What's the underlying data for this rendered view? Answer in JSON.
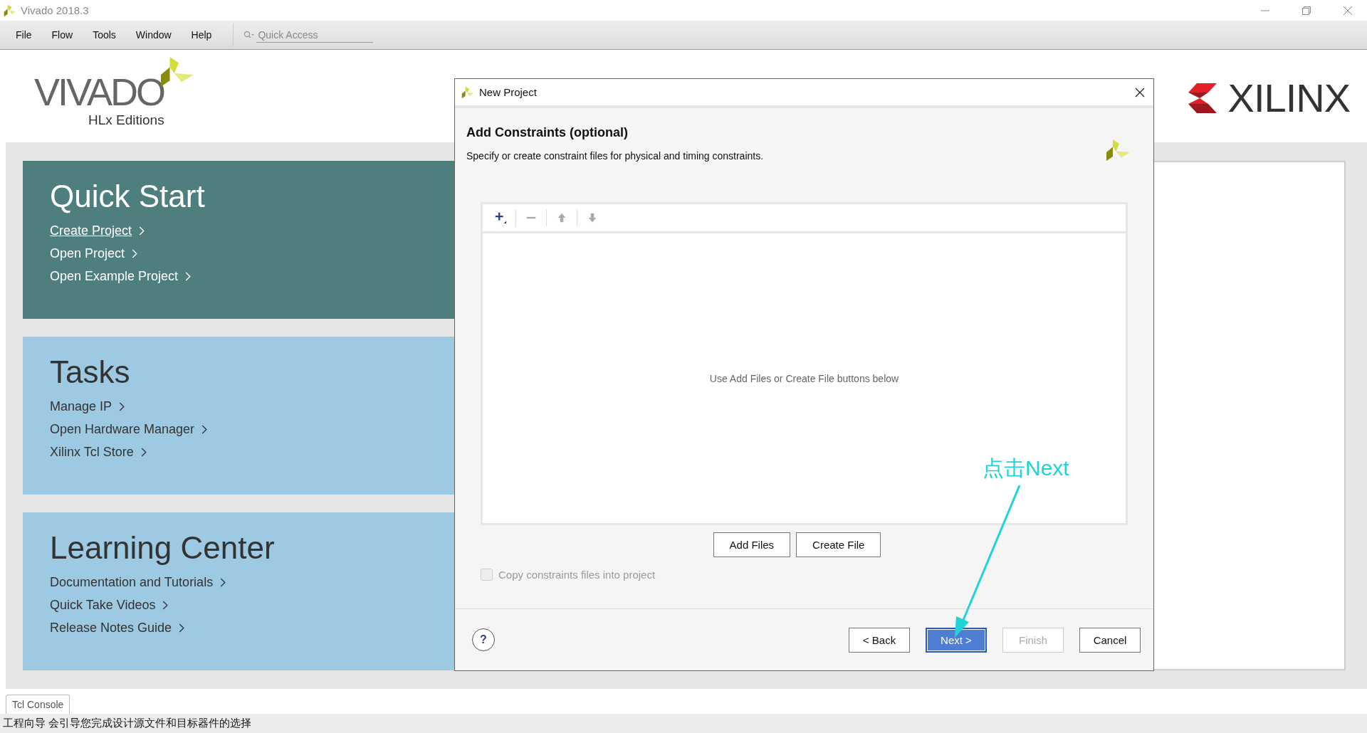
{
  "window": {
    "title": "Vivado 2018.3"
  },
  "menu": [
    "File",
    "Flow",
    "Tools",
    "Window",
    "Help"
  ],
  "quick_access": {
    "placeholder": "Quick Access"
  },
  "logo": {
    "name": "VIVADO",
    "edition": "HLx Editions"
  },
  "brand": "XILINX",
  "panels": [
    {
      "title": "Quick Start",
      "kind": "primary",
      "links": [
        {
          "label": "Create Project",
          "focused": true
        },
        {
          "label": "Open Project",
          "focused": false
        },
        {
          "label": "Open Example Project",
          "focused": false
        }
      ]
    },
    {
      "title": "Tasks",
      "kind": "secondary",
      "links": [
        {
          "label": "Manage IP",
          "focused": false
        },
        {
          "label": "Open Hardware Manager",
          "focused": false
        },
        {
          "label": "Xilinx Tcl Store",
          "focused": false
        }
      ]
    },
    {
      "title": "Learning Center",
      "kind": "secondary",
      "links": [
        {
          "label": "Documentation and Tutorials",
          "focused": false
        },
        {
          "label": "Quick Take Videos",
          "focused": false
        },
        {
          "label": "Release Notes Guide",
          "focused": false
        }
      ]
    }
  ],
  "dialog": {
    "title": "New Project",
    "heading": "Add Constraints (optional)",
    "description": "Specify or create constraint files for physical and timing constraints.",
    "toolbar": [
      {
        "kind": "add",
        "disabled": false
      },
      {
        "kind": "remove",
        "disabled": true
      },
      {
        "kind": "up",
        "disabled": true
      },
      {
        "kind": "down",
        "disabled": true
      }
    ],
    "empty_message": "Use Add Files or Create File buttons below",
    "file_buttons": [
      "Add Files",
      "Create File"
    ],
    "checkbox": {
      "label": "Copy constraints files into project",
      "checked": false,
      "disabled": true
    },
    "help": "?",
    "footer_buttons": [
      {
        "label": "< Back",
        "default": false,
        "disabled": false
      },
      {
        "label": "Next >",
        "default": true,
        "disabled": false
      },
      {
        "label": "Finish",
        "default": false,
        "disabled": true
      },
      {
        "label": "Cancel",
        "default": false,
        "disabled": false
      }
    ]
  },
  "annotation": "点击Next",
  "console_tab": "Tcl Console",
  "status_bar": "工程向导 会引导您完成设计源文件和目标器件的选择"
}
